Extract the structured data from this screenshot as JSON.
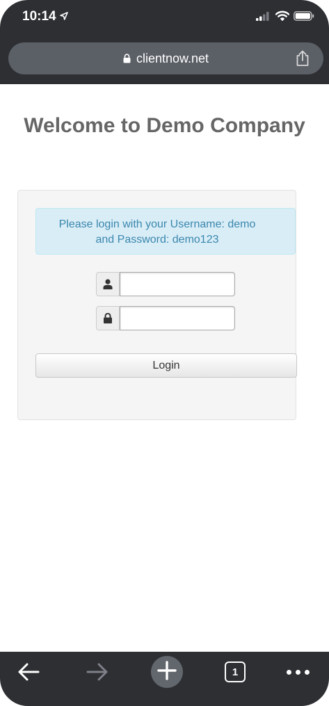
{
  "status_bar": {
    "time": "10:14"
  },
  "browser": {
    "url": "clientnow.net",
    "tab_count": "1"
  },
  "page": {
    "title": "Welcome to Demo Company",
    "alert_line1": "Please login with your Username: demo",
    "alert_line2": "and Password: demo123",
    "username_value": "",
    "password_value": "",
    "login_label": "Login"
  },
  "icons": {
    "location": "location-arrow-icon",
    "signal": "cellular-signal-icon",
    "wifi": "wifi-icon",
    "battery": "battery-icon",
    "lock": "lock-icon",
    "share": "share-icon",
    "user": "user-icon",
    "password_lock": "padlock-icon",
    "back": "back-arrow-icon",
    "forward": "forward-arrow-icon",
    "new_tab": "plus-icon",
    "more": "more-dots-icon"
  },
  "colors": {
    "chrome_bg": "#2d2f33",
    "urlbar_bg": "#5b5f66",
    "alert_bg": "#d9edf7",
    "alert_text": "#3a87ad",
    "title_text": "#666666"
  }
}
